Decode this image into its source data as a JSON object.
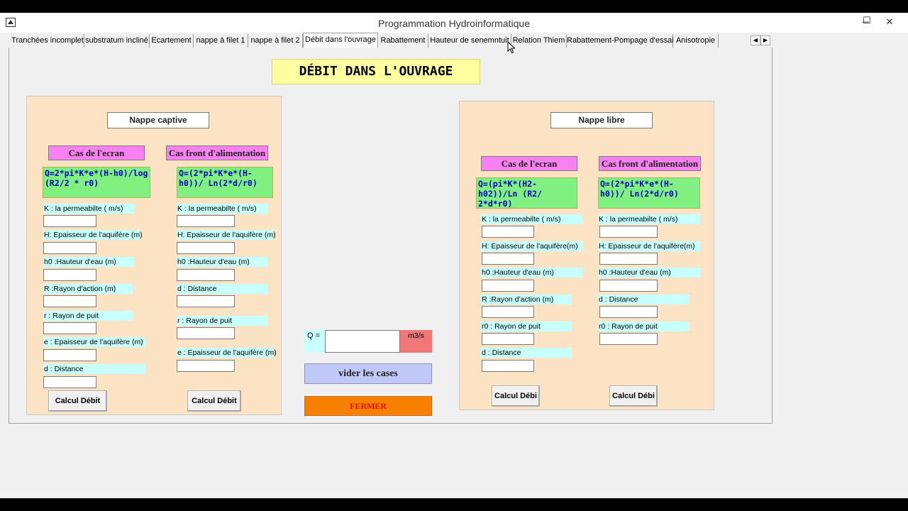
{
  "window": {
    "title": "Programmation Hydroinformatique",
    "controls": {
      "minimize": "─",
      "maximize": "☐",
      "close": "✕"
    }
  },
  "tabs": [
    {
      "label": "Tranchées incomplet",
      "active": false
    },
    {
      "label": "substratum incliné",
      "active": false
    },
    {
      "label": "Ecartement",
      "active": false
    },
    {
      "label": "nappe à filet 1",
      "active": false
    },
    {
      "label": "nappe à filet 2",
      "active": false
    },
    {
      "label": "Débit dans l'ouvrage",
      "active": true
    },
    {
      "label": "Rabattement",
      "active": false
    },
    {
      "label": "Hauteur de senemntuit",
      "active": false
    },
    {
      "label": "Relation Thiem",
      "active": false
    },
    {
      "label": "Rabattement-Pompage d'essai",
      "active": false
    },
    {
      "label": "Anisotropie",
      "active": false
    }
  ],
  "tab_scroll": {
    "left": "◀",
    "right": "▶"
  },
  "page_header": "DÉBIT DANS L'OUVRAGE",
  "captive": {
    "title": "Nappe captive",
    "ecran": {
      "label": "Cas de l'ecran",
      "formula": "Q=2*pi*K*e*(H-h0)/log (R2/2  * r0)",
      "fields": [
        {
          "label": "K : la permeabilte ( m/s)",
          "value": ""
        },
        {
          "label": "H: Epaisseur de l'aquifère (m)",
          "value": ""
        },
        {
          "label": "h0 :Hauteur d'eau  (m)",
          "value": ""
        },
        {
          "label": "R :Rayon d'action (m)",
          "value": ""
        },
        {
          "label": "r : Rayon de puit",
          "value": ""
        },
        {
          "label": "e : Epaisseur de l'aquifère (m)",
          "value": ""
        },
        {
          "label": "  d : Distance",
          "value": ""
        }
      ],
      "button": "Calcul Débit"
    },
    "front": {
      "label": "Cas front d'alimentation",
      "formula": "Q=(2*pi*K*e*(H-h0))/ Ln(2*d/r0)",
      "fields": [
        {
          "label": "K : la permeabilte  ( m/s)",
          "value": ""
        },
        {
          "label": "H: Epaisseur de l'aquifère (m)",
          "value": ""
        },
        {
          "label": "h0 :Hauteur d'eau  (m)",
          "value": ""
        },
        {
          "label": "d : Distance",
          "value": ""
        },
        {
          "label": "r : Rayon de puit",
          "value": ""
        },
        {
          "label": "e : Epaisseur de l'aquifère (m)",
          "value": ""
        }
      ],
      "button": "Calcul Débit"
    }
  },
  "libre": {
    "title": "Nappe libre",
    "ecran": {
      "label": "Cas de l'ecran",
      "formula": "Q=(pi*K*(H2-h02))/Ln (R2/ 2*d*r0)",
      "fields": [
        {
          "label": "K : la permeabilte ( m/s)",
          "value": ""
        },
        {
          "label": "H: Epaisseur de l'aquifère(m)",
          "value": ""
        },
        {
          "label": "h0 :Hauteur d'eau  (m)",
          "value": ""
        },
        {
          "label": "R :Rayon d'action (m)",
          "value": ""
        },
        {
          "label": "r0 : Rayon de puit",
          "value": ""
        },
        {
          "label": "d : Distance",
          "value": ""
        }
      ],
      "button": "Calcul Débi"
    },
    "front": {
      "label": "Cas front d'alimentation",
      "formula": "Q=(2*pi*K*e*(H-h0))/ Ln(2*d/r0)",
      "fields": [
        {
          "label": "K : la permeabilte ( m/s)",
          "value": ""
        },
        {
          "label": "H: Epaisseur de l'aquifère(m)",
          "value": ""
        },
        {
          "label": "h0 :Hauteur d'eau  (m)",
          "value": ""
        },
        {
          "label": "d : Distance",
          "value": ""
        },
        {
          "label": "r0 : Rayon de puit",
          "value": ""
        }
      ],
      "button": "Calcul Débi"
    }
  },
  "result": {
    "label": "Q =",
    "value": "",
    "unit": "m3/s"
  },
  "actions": {
    "clear": "vider les cases",
    "close": "FERMER"
  },
  "colors": {
    "panel_bg": "#fbe3c4",
    "header_bg": "#ffffa0",
    "pink_label": "#f880f0",
    "formula_bg": "#80f080",
    "formula_text": "#0000c0",
    "field_label_bg": "#c8ffff",
    "unit_bg": "#f07878",
    "clear_btn_bg": "#c0c8f8",
    "close_btn_bg": "#f88000",
    "close_btn_text": "#e01010"
  }
}
